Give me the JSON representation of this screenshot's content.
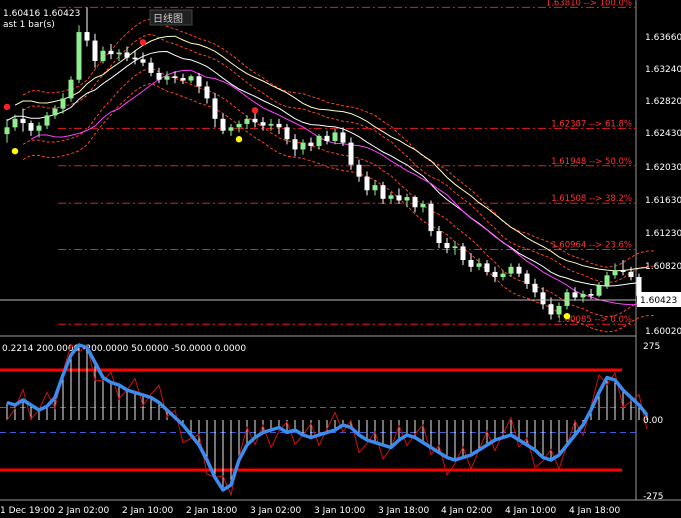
{
  "header": {
    "price_info": "1.60416 1.60423",
    "bars_info": "ast 1 bar(s)",
    "timeframe_tag": "日线图"
  },
  "current_price": "1.60423",
  "price_ticks": [
    "1.63660",
    "1.63240",
    "1.62820",
    "1.62430",
    "1.62030",
    "1.61630",
    "1.61230",
    "1.60820",
    "1.60020"
  ],
  "fib_levels": [
    {
      "label": "1.63810 --> 100.0%"
    },
    {
      "label": "1.62387 --> 61.8%"
    },
    {
      "label": "1.61948 --> 50.0%"
    },
    {
      "label": "1.61508 --> 38.2%"
    },
    {
      "label": "1.60964 --> 23.6%"
    },
    {
      "label": "1.60085 --> 0.0%"
    }
  ],
  "indicator": {
    "info": "0.2214 200.0000 -200.0000 50.0000 -50.0000 0.0000",
    "ticks": [
      "275",
      "0.00",
      "-275"
    ]
  },
  "time_axis": [
    "1 Dec 19:00",
    "2 Jan 02:00",
    "2 Jan 10:00",
    "2 Jan 18:00",
    "3 Jan 02:00",
    "3 Jan 10:00",
    "3 Jan 18:00",
    "4 Jan 02:00",
    "4 Jan 10:00",
    "4 Jan 18:00"
  ],
  "colors": {
    "bull": "#90ee90",
    "bear": "#ffffff",
    "fib": "#e02020",
    "envelope": "#ff4020",
    "band_outer": "#ffffc0",
    "band_lower": "#ff40ff",
    "cci": "#3c8cf0",
    "cci_fast": "#d01010",
    "level": "#ff0000",
    "dash": "#3b5fdc"
  },
  "chart_data": {
    "type": "candlestick",
    "price_ylim": [
      1.5997,
      1.6385
    ],
    "candles": [
      [
        1.6232,
        1.625,
        1.6222,
        1.624
      ],
      [
        1.624,
        1.6255,
        1.6236,
        1.625
      ],
      [
        1.625,
        1.6262,
        1.6235,
        1.6245
      ],
      [
        1.6245,
        1.6248,
        1.623,
        1.6236
      ],
      [
        1.6236,
        1.6246,
        1.6228,
        1.6242
      ],
      [
        1.6242,
        1.6258,
        1.6238,
        1.6254
      ],
      [
        1.6254,
        1.6266,
        1.625,
        1.6262
      ],
      [
        1.6262,
        1.628,
        1.6256,
        1.6274
      ],
      [
        1.6274,
        1.63,
        1.627,
        1.6296
      ],
      [
        1.6296,
        1.636,
        1.6292,
        1.6352
      ],
      [
        1.6352,
        1.6381,
        1.6335,
        1.6342
      ],
      [
        1.6342,
        1.635,
        1.631,
        1.6318
      ],
      [
        1.6318,
        1.6335,
        1.6315,
        1.633
      ],
      [
        1.633,
        1.6338,
        1.632,
        1.6326
      ],
      [
        1.6326,
        1.6332,
        1.6318,
        1.6328
      ],
      [
        1.6328,
        1.6335,
        1.6318,
        1.6322
      ],
      [
        1.6322,
        1.633,
        1.6314,
        1.632
      ],
      [
        1.632,
        1.6328,
        1.6312,
        1.6316
      ],
      [
        1.6316,
        1.6322,
        1.63,
        1.6304
      ],
      [
        1.6304,
        1.631,
        1.6292,
        1.6296
      ],
      [
        1.6296,
        1.6306,
        1.629,
        1.63
      ],
      [
        1.63,
        1.6306,
        1.6292,
        1.6298
      ],
      [
        1.6298,
        1.6303,
        1.6291,
        1.6295
      ],
      [
        1.6295,
        1.6302,
        1.6292,
        1.63
      ],
      [
        1.63,
        1.6304,
        1.628,
        1.6288
      ],
      [
        1.6288,
        1.6294,
        1.6268,
        1.6274
      ],
      [
        1.6274,
        1.628,
        1.624,
        1.625
      ],
      [
        1.625,
        1.6256,
        1.6232,
        1.6236
      ],
      [
        1.6236,
        1.6244,
        1.623,
        1.624
      ],
      [
        1.624,
        1.6248,
        1.6234,
        1.6244
      ],
      [
        1.6244,
        1.6254,
        1.6238,
        1.625
      ],
      [
        1.625,
        1.6258,
        1.624,
        1.6246
      ],
      [
        1.6246,
        1.6252,
        1.6236,
        1.6242
      ],
      [
        1.6242,
        1.625,
        1.6236,
        1.6244
      ],
      [
        1.6244,
        1.625,
        1.6232,
        1.624
      ],
      [
        1.624,
        1.6244,
        1.622,
        1.6226
      ],
      [
        1.6226,
        1.6232,
        1.6206,
        1.6214
      ],
      [
        1.6214,
        1.6226,
        1.6208,
        1.6222
      ],
      [
        1.6222,
        1.6228,
        1.6212,
        1.6218
      ],
      [
        1.6218,
        1.6232,
        1.6214,
        1.623
      ],
      [
        1.623,
        1.6236,
        1.622,
        1.6224
      ],
      [
        1.6224,
        1.6238,
        1.622,
        1.6234
      ],
      [
        1.6234,
        1.624,
        1.6218,
        1.6222
      ],
      [
        1.6222,
        1.6228,
        1.619,
        1.6196
      ],
      [
        1.6196,
        1.6202,
        1.6176,
        1.6182
      ],
      [
        1.6182,
        1.6188,
        1.616,
        1.6166
      ],
      [
        1.6166,
        1.6178,
        1.616,
        1.6172
      ],
      [
        1.6172,
        1.6176,
        1.615,
        1.6156
      ],
      [
        1.6156,
        1.6164,
        1.615,
        1.616
      ],
      [
        1.616,
        1.6168,
        1.615,
        1.6154
      ],
      [
        1.6154,
        1.6162,
        1.6146,
        1.6158
      ],
      [
        1.6158,
        1.616,
        1.614,
        1.6146
      ],
      [
        1.6146,
        1.6154,
        1.614,
        1.615
      ],
      [
        1.615,
        1.6154,
        1.6112,
        1.6118
      ],
      [
        1.6118,
        1.6124,
        1.6098,
        1.6104
      ],
      [
        1.6104,
        1.611,
        1.6092,
        1.6098
      ],
      [
        1.6098,
        1.6106,
        1.609,
        1.61
      ],
      [
        1.61,
        1.6104,
        1.6078,
        1.6084
      ],
      [
        1.6084,
        1.6092,
        1.607,
        1.6076
      ],
      [
        1.6076,
        1.6086,
        1.6072,
        1.608
      ],
      [
        1.608,
        1.6084,
        1.6066,
        1.607
      ],
      [
        1.607,
        1.6076,
        1.6058,
        1.6064
      ],
      [
        1.6064,
        1.6072,
        1.606,
        1.6068
      ],
      [
        1.6068,
        1.608,
        1.6064,
        1.6076
      ],
      [
        1.6076,
        1.608,
        1.6064,
        1.6068
      ],
      [
        1.6068,
        1.6072,
        1.605,
        1.6056
      ],
      [
        1.6056,
        1.6062,
        1.604,
        1.6046
      ],
      [
        1.6046,
        1.6052,
        1.6026,
        1.6032
      ],
      [
        1.6032,
        1.604,
        1.6014,
        1.602
      ],
      [
        1.602,
        1.6034,
        1.6016,
        1.603
      ],
      [
        1.603,
        1.605,
        1.6026,
        1.6046
      ],
      [
        1.6046,
        1.6052,
        1.6036,
        1.604
      ],
      [
        1.604,
        1.6048,
        1.6034,
        1.6044
      ],
      [
        1.6044,
        1.605,
        1.6038,
        1.6042
      ],
      [
        1.6042,
        1.6058,
        1.604,
        1.6054
      ],
      [
        1.6054,
        1.607,
        1.605,
        1.6066
      ],
      [
        1.6066,
        1.608,
        1.6062,
        1.6072
      ],
      [
        1.6072,
        1.6084,
        1.6066,
        1.607
      ],
      [
        1.607,
        1.6076,
        1.606,
        1.6064
      ],
      [
        1.6064,
        1.6068,
        1.6036,
        1.6042
      ]
    ],
    "dots": [
      {
        "i": 1,
        "price": 1.6212,
        "color": "#ffff00"
      },
      {
        "i": 0,
        "price": 1.6264,
        "color": "#ff2020"
      },
      {
        "i": 17,
        "price": 1.634,
        "color": "#ff2020"
      },
      {
        "i": 29,
        "price": 1.6226,
        "color": "#ffff00"
      },
      {
        "i": 31,
        "price": 1.626,
        "color": "#ff2020"
      },
      {
        "i": 70,
        "price": 1.6018,
        "color": "#ffff00"
      }
    ],
    "cci_ylim": [
      -300,
      300
    ],
    "cci_levels": [
      200,
      -200
    ],
    "cci_dash": [
      50,
      -50
    ],
    "cci": [
      70,
      60,
      80,
      60,
      40,
      55,
      90,
      180,
      260,
      300,
      290,
      230,
      170,
      150,
      140,
      120,
      110,
      100,
      90,
      70,
      40,
      10,
      -20,
      -60,
      -100,
      -160,
      -230,
      -280,
      -260,
      -160,
      -100,
      -70,
      -50,
      -40,
      -30,
      -50,
      -40,
      -60,
      -70,
      -60,
      -50,
      -40,
      -20,
      -30,
      -60,
      -80,
      -90,
      -100,
      -110,
      -80,
      -60,
      -70,
      -90,
      -110,
      -130,
      -150,
      -160,
      -150,
      -140,
      -120,
      -100,
      -80,
      -70,
      -60,
      -80,
      -100,
      -120,
      -150,
      -160,
      -140,
      -100,
      -60,
      -20,
      40,
      110,
      170,
      160,
      120,
      90,
      60,
      20
    ]
  }
}
